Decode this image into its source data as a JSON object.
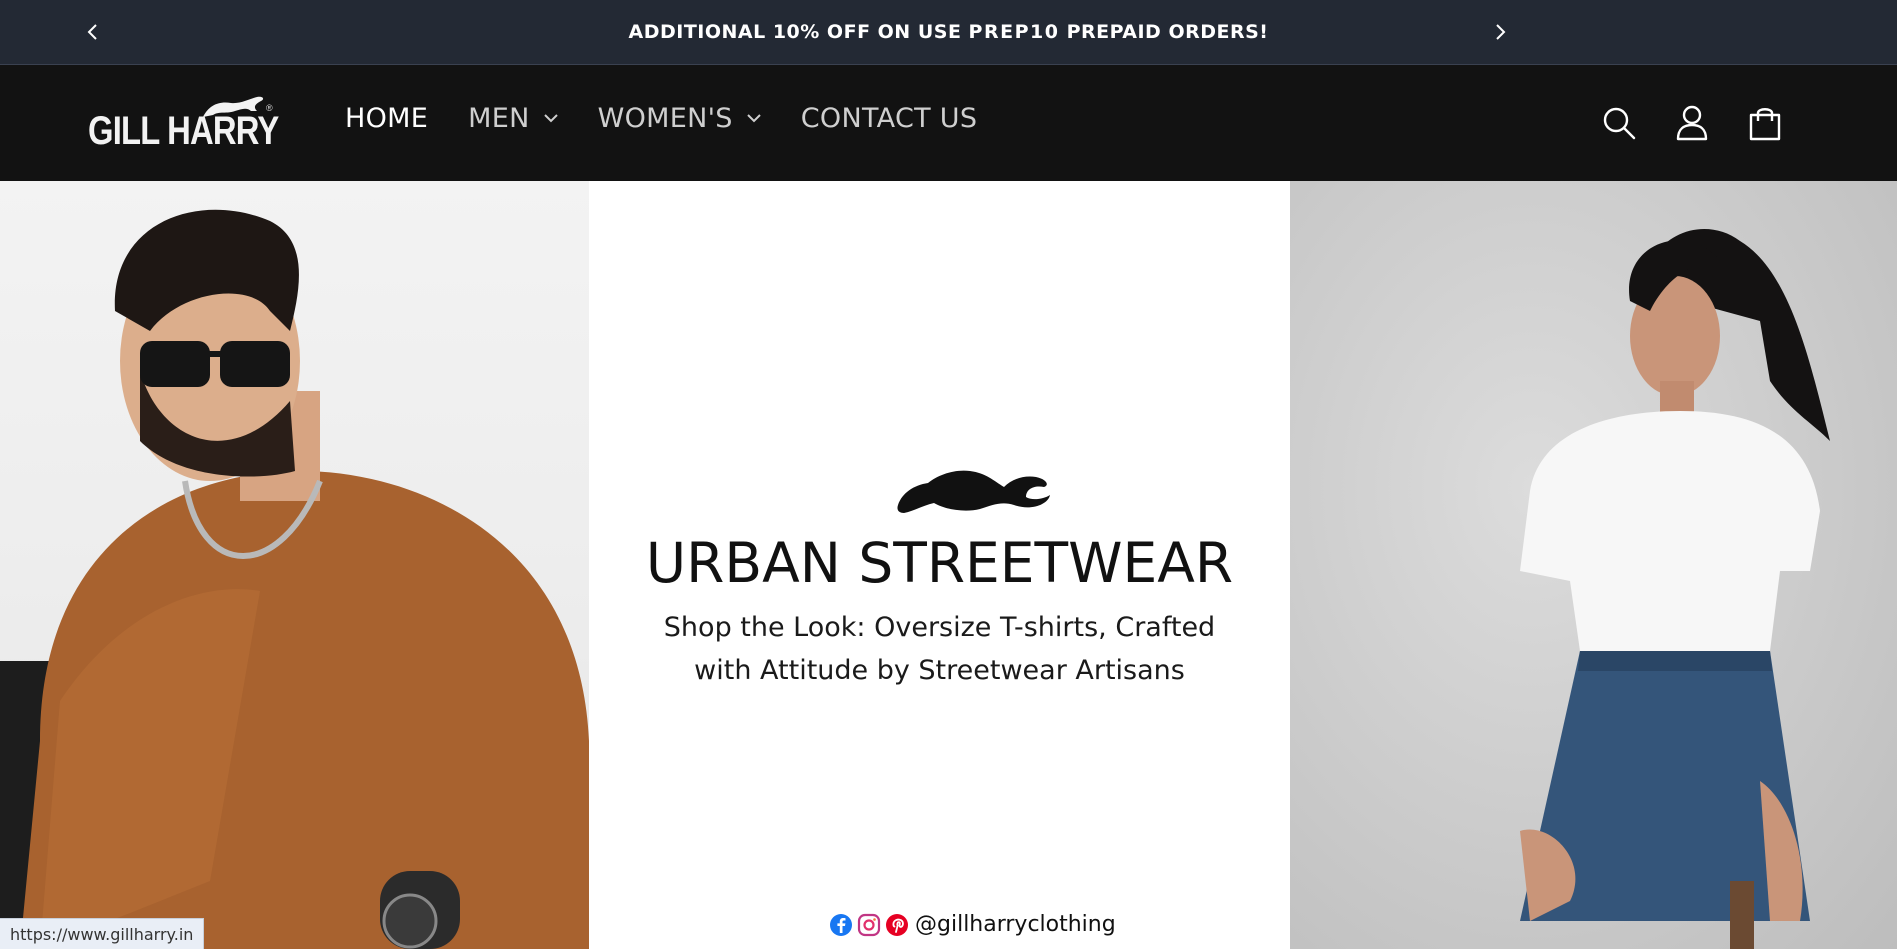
{
  "announcement": {
    "text_before": "ADDITIONAL 10% OFF ON USE ",
    "code": "PREP10",
    "text_after": " PREPAID ORDERS!",
    "prev_icon": "chevron-left-icon",
    "next_icon": "chevron-right-icon"
  },
  "header": {
    "logo_text": "GILL HARRY",
    "nav": [
      {
        "label": "HOME",
        "active": true
      },
      {
        "label": "MEN",
        "has_dropdown": true
      },
      {
        "label": "WOMEN'S",
        "has_dropdown": true
      },
      {
        "label": "CONTACT US"
      }
    ],
    "icons": [
      "search-icon",
      "account-icon",
      "cart-icon"
    ]
  },
  "hero": {
    "title": "URBAN STREETWEAR",
    "subtitle_line1": "Shop the Look: Oversize T-shirts, Crafted",
    "subtitle_line2": "with Attitude by Streetwear Artisans",
    "social_icons": [
      "facebook-icon",
      "instagram-icon",
      "pinterest-icon"
    ],
    "handle": "@gillharryclothing"
  },
  "status_bar": {
    "url": "https://www.gillharry.in"
  },
  "colors": {
    "announcement_bg": "#232934",
    "header_bg": "#121212",
    "facebook": "#1877f2",
    "pinterest": "#e60023"
  }
}
